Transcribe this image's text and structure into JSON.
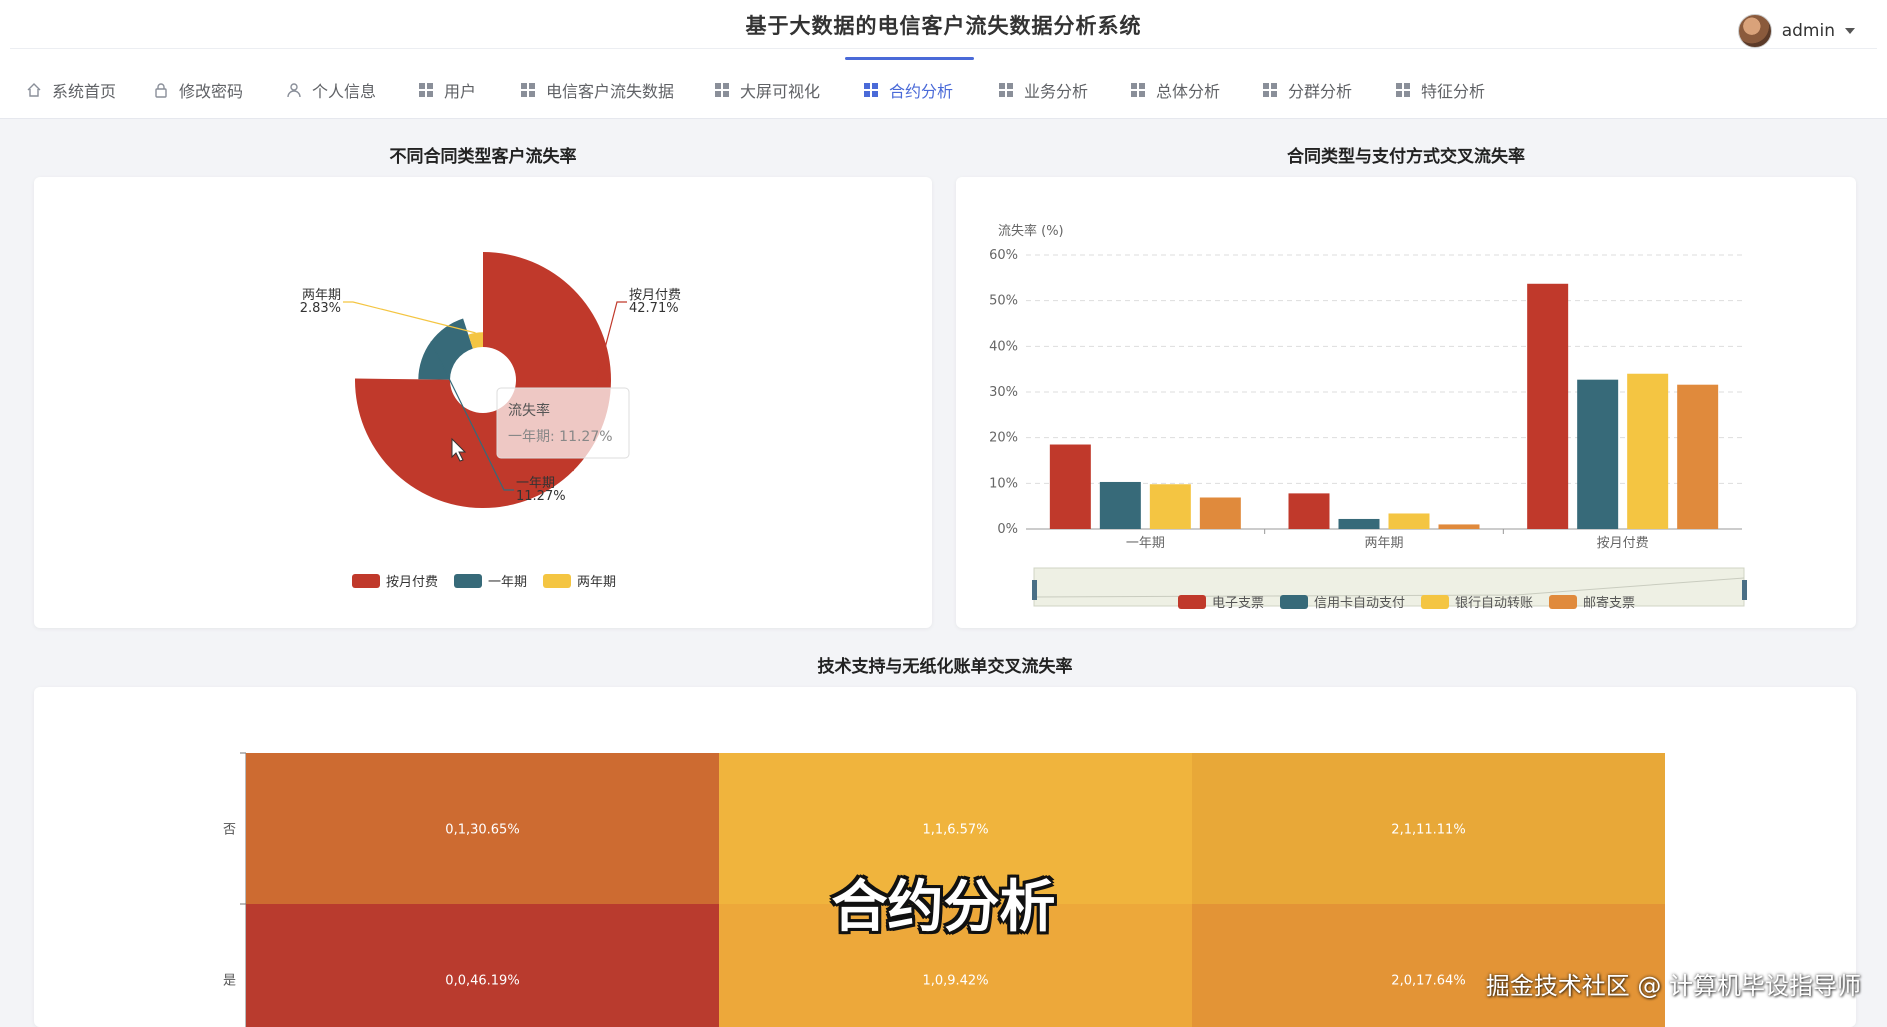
{
  "app": {
    "title": "基于大数据的电信客户流失数据分析系统"
  },
  "nav": {
    "items": [
      {
        "label": "系统首页",
        "icon": "home-icon"
      },
      {
        "label": "修改密码",
        "icon": "lock-icon"
      },
      {
        "label": "个人信息",
        "icon": "user-icon"
      },
      {
        "label": "用户",
        "icon": "grid-icon"
      },
      {
        "label": "电信客户流失数据",
        "icon": "grid-icon"
      },
      {
        "label": "大屏可视化",
        "icon": "grid-icon"
      },
      {
        "label": "合约分析",
        "icon": "grid-icon",
        "active": true
      },
      {
        "label": "业务分析",
        "icon": "grid-icon"
      },
      {
        "label": "总体分析",
        "icon": "grid-icon"
      },
      {
        "label": "分群分析",
        "icon": "grid-icon"
      },
      {
        "label": "特征分析",
        "icon": "grid-icon"
      }
    ],
    "user": {
      "name": "admin"
    }
  },
  "charts": {
    "contract": {
      "title": "不同合同类型客户流失率",
      "tooltip": {
        "header": "流失率",
        "text": "一年期: 11.27%"
      }
    },
    "cross": {
      "title": "合同类型与支付方式交叉流失率"
    },
    "heatmap": {
      "title": "技术支持与无纸化账单交叉流失率"
    }
  },
  "chart_data": [
    {
      "type": "pie",
      "title": "不同合同类型客户流失率",
      "rose": true,
      "slices": [
        {
          "name": "按月付费",
          "value": 42.71,
          "label": "42.71%",
          "color": "#c0392b"
        },
        {
          "name": "一年期",
          "value": 11.27,
          "label": "11.27%",
          "color": "#376a79"
        },
        {
          "name": "两年期",
          "value": 2.83,
          "label": "2.83%",
          "color": "#f4c542"
        }
      ],
      "legend": [
        "按月付费",
        "一年期",
        "两年期"
      ],
      "legend_position": "bottom"
    },
    {
      "type": "bar",
      "title": "合同类型与支付方式交叉流失率",
      "ylabel": "流失率 (%)",
      "ylim": [
        0,
        60
      ],
      "yticks": [
        "0%",
        "10%",
        "20%",
        "30%",
        "40%",
        "50%",
        "60%"
      ],
      "categories": [
        "一年期",
        "两年期",
        "按月付费"
      ],
      "series": [
        {
          "name": "电子支票",
          "values": [
            18.5,
            7.8,
            53.7
          ],
          "color": "#c0392b"
        },
        {
          "name": "信用卡自动支付",
          "values": [
            10.3,
            2.2,
            32.7
          ],
          "color": "#376a79"
        },
        {
          "name": "银行自动转账",
          "values": [
            9.8,
            3.4,
            34.0
          ],
          "color": "#f4c542"
        },
        {
          "name": "邮寄支票",
          "values": [
            6.9,
            1.0,
            31.6
          ],
          "color": "#e08a3c"
        }
      ],
      "legend_position": "bottom",
      "grid": true
    },
    {
      "type": "heatmap",
      "title": "技术支持与无纸化账单交叉流失率",
      "y_categories": [
        "否",
        "是"
      ],
      "cells": [
        {
          "x": 0,
          "y": 0,
          "label": "0,1,30.65%",
          "value": 30.65,
          "color": "#cd6b31"
        },
        {
          "x": 1,
          "y": 0,
          "label": "1,1,6.57%",
          "value": 6.57,
          "color": "#f0b43d"
        },
        {
          "x": 2,
          "y": 0,
          "label": "2,1,11.11%",
          "value": 11.11,
          "color": "#e8a838"
        },
        {
          "x": 0,
          "y": 1,
          "label": "0,0,46.19%",
          "value": 46.19,
          "color": "#b93b2e"
        },
        {
          "x": 1,
          "y": 1,
          "label": "1,0,9.42%",
          "value": 9.42,
          "color": "#eda83a"
        },
        {
          "x": 2,
          "y": 1,
          "label": "2,0,17.64%",
          "value": 17.64,
          "color": "#e39436"
        }
      ]
    }
  ],
  "overlay": {
    "caption": "合约分析",
    "credit": "掘金技术社区 @ 计算机毕设指导师"
  }
}
